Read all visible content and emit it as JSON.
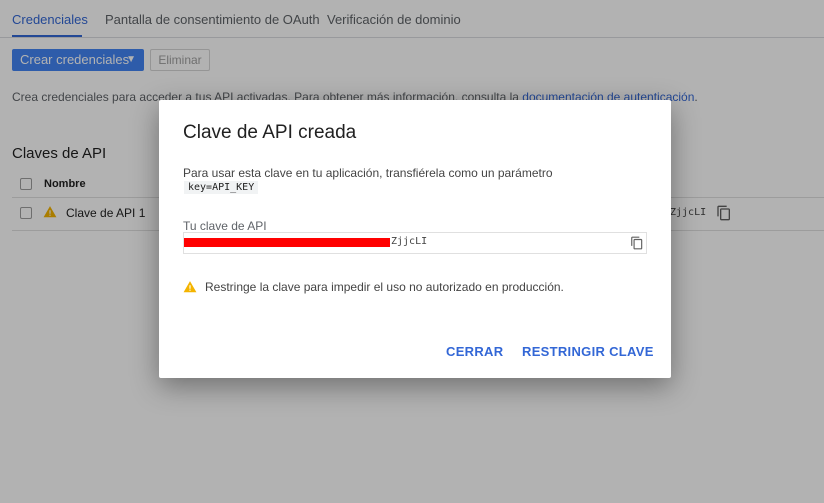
{
  "tabs": [
    {
      "label": "Credenciales",
      "active": true
    },
    {
      "label": "Pantalla de consentimiento de OAuth",
      "active": false
    },
    {
      "label": "Verificación de dominio",
      "active": false
    }
  ],
  "toolbar": {
    "create_label": "Crear credenciales",
    "delete_label": "Eliminar"
  },
  "info": {
    "text": "Crea credenciales para acceder a tus API activadas. Para obtener más información, consulta la ",
    "link": "documentación de autenticación",
    "suffix": "."
  },
  "api_keys": {
    "title": "Claves de API",
    "column_name": "Nombre",
    "rows": [
      {
        "name": "Clave de API 1",
        "key_tail": "ZjjcLI"
      }
    ]
  },
  "dialog": {
    "title": "Clave de API creada",
    "description": "Para usar esta clave en tu aplicación, transfiérela como un parámetro",
    "param_code": "key=API_KEY",
    "key_label": "Tu clave de API",
    "key_tail": "ZjjcLI",
    "warning": "Restringe la clave para impedir el uso no autorizado en producción.",
    "close_label": "CERRAR",
    "restrict_label": "RESTRINGIR CLAVE"
  },
  "colors": {
    "accent": "#3367d6",
    "primary_button": "#4285f4",
    "warning": "#f4b400",
    "redaction": "#ff0000"
  },
  "icons": {
    "dropdown": "caret-down-icon",
    "warning": "warning-icon",
    "copy": "copy-icon"
  }
}
